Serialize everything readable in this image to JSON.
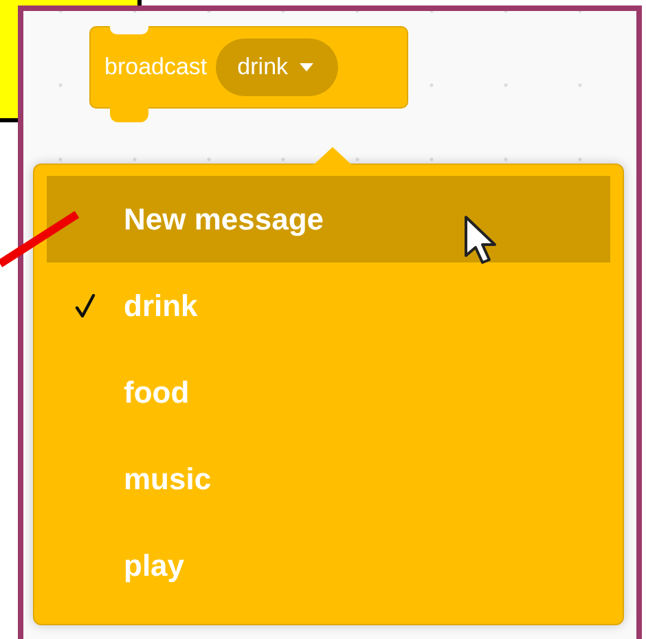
{
  "block": {
    "label": "broadcast",
    "value": "drink"
  },
  "menu": {
    "items": [
      {
        "label": "New message",
        "selected": false,
        "highlighted": true
      },
      {
        "label": "drink",
        "selected": true,
        "highlighted": false
      },
      {
        "label": "food",
        "selected": false,
        "highlighted": false
      },
      {
        "label": "music",
        "selected": false,
        "highlighted": false
      },
      {
        "label": "play",
        "selected": false,
        "highlighted": false
      }
    ]
  }
}
